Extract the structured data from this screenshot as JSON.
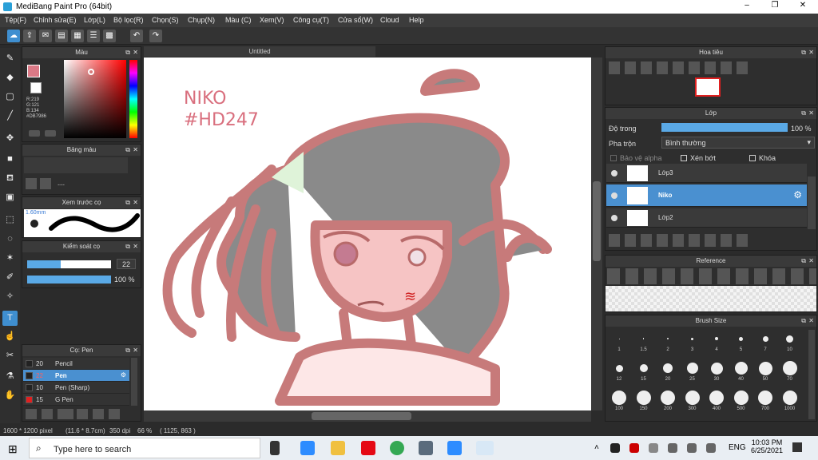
{
  "window": {
    "title": "MediBang Paint Pro (64bit)",
    "minimize": "–",
    "maximize": "❐",
    "close": "✕"
  },
  "menu": [
    "Tệp(F)",
    "Chỉnh sửa(E)",
    "Lớp(L)",
    "Bộ lọc(R)",
    "Chọn(S)",
    "Chụp(N)",
    "Màu (C)",
    "Xem(V)",
    "Công cụ(T)",
    "Cửa sổ(W)",
    "Cloud",
    "Help"
  ],
  "color_panel": {
    "title": "Màu",
    "primary_color": "#DB7986",
    "r": "R:219",
    "g": "G:121",
    "b": "B:134",
    "hex": "#DB7986"
  },
  "palette_panel": {
    "title": "Bảng màu",
    "placeholder": "---"
  },
  "preview_panel": {
    "title": "Xem trước cọ",
    "size": "1.60mm"
  },
  "control_panel": {
    "title": "Kiểm soát cọ",
    "size_value": "22",
    "opacity_value": "100 %",
    "size_fill": 0.4,
    "opacity_fill": 1.0
  },
  "brush_panel": {
    "title": "Cọ: Pen",
    "brushes": [
      {
        "size": "20",
        "name": "Pencil",
        "color": "#222222"
      },
      {
        "size": "22",
        "name": "Pen",
        "color": "#222222"
      },
      {
        "size": "10",
        "name": "Pen (Sharp)",
        "color": "#222222"
      },
      {
        "size": "15",
        "name": "G Pen",
        "color": "#e02020"
      }
    ]
  },
  "canvas": {
    "tab": "Untitled",
    "text_line1": "NIKO",
    "text_line2": "#HD247"
  },
  "navigator_panel": {
    "title": "Hoa tiêu"
  },
  "layer_panel": {
    "title": "Lớp",
    "opacity_label": "Độ trong",
    "opacity_value": "100 %",
    "opacity_fill": 1.0,
    "blend_label": "Pha trộn",
    "blend_value": "Bình thường",
    "protect_alpha": "Bảo vệ alpha",
    "clipping": "Xén bớt",
    "lock": "Khóa",
    "layers": [
      {
        "name": "Lớp3",
        "selected": false
      },
      {
        "name": "Niko",
        "selected": true
      },
      {
        "name": "Lớp2",
        "selected": false
      }
    ]
  },
  "reference_panel": {
    "title": "Reference"
  },
  "brush_size_panel": {
    "title": "Brush Size",
    "sizes": [
      "1",
      "1.5",
      "2",
      "3",
      "4",
      "5",
      "7",
      "10",
      "12",
      "15",
      "20",
      "25",
      "30",
      "40",
      "50",
      "70",
      "100",
      "150",
      "200",
      "300",
      "400",
      "500",
      "700",
      "1000"
    ]
  },
  "status": {
    "dimensions": "1600 * 1200 pixel",
    "physical": "(11.6 * 8.7cm)",
    "dpi": "350 dpi",
    "zoom": "66 %",
    "coords": "( 1125, 863 )"
  },
  "taskbar": {
    "search_placeholder": "Type here to search",
    "lang": "ENG",
    "time": "10:03 PM",
    "date": "6/25/2021"
  },
  "colors": {
    "accent": "#4a90d0",
    "stroke": "#c77a7a",
    "hair": "#8a8a8a"
  }
}
